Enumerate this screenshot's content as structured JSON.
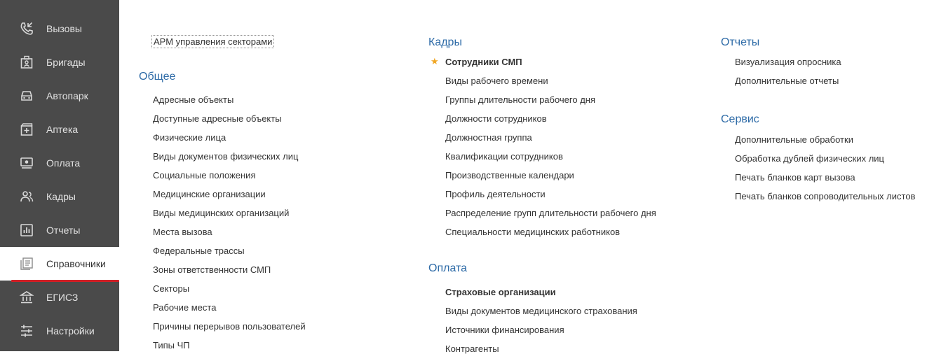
{
  "sidebar": {
    "items": [
      {
        "label": "Вызовы",
        "icon": "phone-calls-icon"
      },
      {
        "label": "Бригады",
        "icon": "team-board-icon"
      },
      {
        "label": "Автопарк",
        "icon": "car-icon"
      },
      {
        "label": "Аптека",
        "icon": "pharmacy-icon"
      },
      {
        "label": "Оплата",
        "icon": "payment-icon"
      },
      {
        "label": "Кадры",
        "icon": "staff-icon"
      },
      {
        "label": "Отчеты",
        "icon": "reports-chart-icon"
      },
      {
        "label": "Справочники",
        "icon": "directory-list-icon",
        "active": true
      },
      {
        "label": "ЕГИСЗ",
        "icon": "government-building-icon"
      },
      {
        "label": "Настройки",
        "icon": "sliders-icon"
      }
    ],
    "active_underline_color": "#cf2027"
  },
  "main": {
    "arm_link": "АРМ управления секторами",
    "general": {
      "title": "Общее",
      "items": [
        "Адресные объекты",
        "Доступные адресные объекты",
        "Физические лица",
        "Виды документов физических лиц",
        "Социальные положения",
        "Медицинские организации",
        "Виды медицинских организаций",
        "Места вызова",
        "Федеральные трассы",
        "Зоны ответственности СМП",
        "Секторы",
        "Рабочие места",
        "Причины перерывов пользователей",
        "Типы ЧП"
      ]
    },
    "staff": {
      "title": "Кадры",
      "items": [
        {
          "label": "Сотрудники СМП",
          "bold": true,
          "starred": true
        },
        {
          "label": "Виды рабочего времени"
        },
        {
          "label": "Группы длительности рабочего дня"
        },
        {
          "label": "Должности сотрудников"
        },
        {
          "label": "Должностная группа"
        },
        {
          "label": "Квалификации сотрудников"
        },
        {
          "label": "Производственные календари"
        },
        {
          "label": "Профиль деятельности"
        },
        {
          "label": "Распределение групп длительности рабочего дня"
        },
        {
          "label": "Специальности медицинских работников"
        }
      ]
    },
    "payment": {
      "title": "Оплата",
      "items": [
        {
          "label": "Страховые организации",
          "bold": true
        },
        {
          "label": "Виды документов медицинского страхования"
        },
        {
          "label": "Источники финансирования"
        },
        {
          "label": "Контрагенты"
        }
      ]
    },
    "reports": {
      "title": "Отчеты",
      "items": [
        "Визуализация опросника",
        "Дополнительные отчеты"
      ]
    },
    "service": {
      "title": "Сервис",
      "items": [
        "Дополнительные обработки",
        "Обработка дублей физических лиц",
        "Печать бланков карт вызова",
        "Печать бланков сопроводительных листов"
      ]
    },
    "colors": {
      "section_title": "#2e6ba7",
      "star": "#f0a623"
    }
  }
}
